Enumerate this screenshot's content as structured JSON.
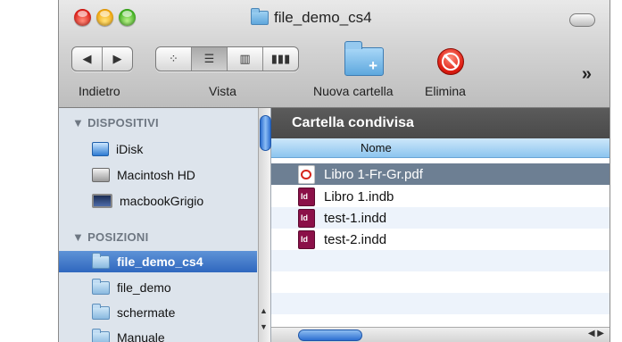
{
  "window": {
    "title": "file_demo_cs4"
  },
  "toolbar": {
    "back_label": "Indietro",
    "view_label": "Vista",
    "new_folder_label": "Nuova cartella",
    "delete_label": "Elimina",
    "more_symbol": "»",
    "nav_back_glyph": "◀",
    "nav_forward_glyph": "▶",
    "view_icons_glyph": "⁘",
    "view_list_glyph": "☰",
    "view_columns_glyph": "▥",
    "view_coverflow_glyph": "▮▮▮",
    "active_view": "list"
  },
  "sidebar": {
    "devices_header": "▼ DISPOSITIVI",
    "devices": [
      {
        "label": "iDisk",
        "icon": "idisk-icon"
      },
      {
        "label": "Macintosh HD",
        "icon": "hard-drive-icon"
      },
      {
        "label": "macbookGrigio",
        "icon": "laptop-icon"
      }
    ],
    "places_header": "▼ POSIZIONI",
    "places": [
      {
        "label": "file_demo_cs4",
        "selected": true
      },
      {
        "label": "file_demo",
        "selected": false
      },
      {
        "label": "schermate",
        "selected": false
      },
      {
        "label": "Manuale",
        "selected": false
      }
    ]
  },
  "content": {
    "path_title": "Cartella condivisa",
    "column_name": "Nome",
    "files": [
      {
        "name": "Libro 1-Fr-Gr.pdf",
        "type": "pdf",
        "selected": true
      },
      {
        "name": "Libro 1.indb",
        "type": "indd",
        "selected": false
      },
      {
        "name": "test-1.indd",
        "type": "indd",
        "selected": false
      },
      {
        "name": "test-2.indd",
        "type": "indd",
        "selected": false
      }
    ]
  },
  "colors": {
    "selection_blue": "#3b73c6",
    "row_selected": "#6d7f93",
    "header_dark": "#4f4f4f"
  }
}
